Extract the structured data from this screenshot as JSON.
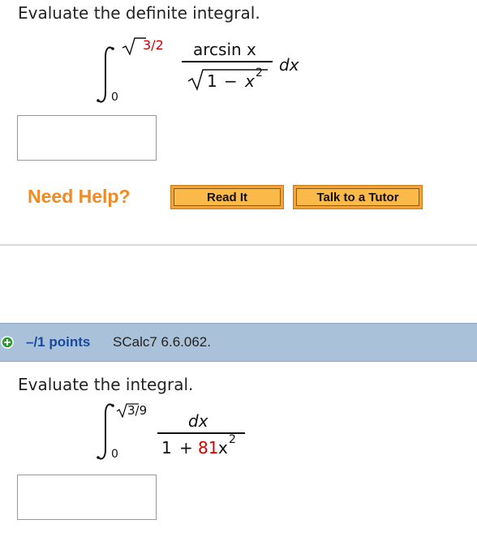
{
  "q1": {
    "prompt": "Evaluate the definite integral.",
    "upper_limit": "3/2",
    "lower_limit": "0",
    "numerator": "arcsin x",
    "denom_one": "1",
    "denom_minus": "−",
    "denom_x": "x",
    "denom_pow": "2",
    "differential": "dx"
  },
  "help": {
    "label": "Need Help?",
    "read_it": "Read It",
    "talk_tutor": "Talk to a Tutor"
  },
  "q2_header": {
    "icon": "plus-circle-icon",
    "points": "–/1 points",
    "source": "SCalc7 6.6.062."
  },
  "q2": {
    "prompt": "Evaluate the integral.",
    "upper_limit": "3/9",
    "lower_limit": "0",
    "numerator": "dx",
    "denom_one": "1",
    "denom_plus": "+",
    "denom_coef": "81",
    "denom_x": "x",
    "denom_pow": "2"
  },
  "colors": {
    "accent_orange": "#f08a24",
    "bar_blue": "#a9c2d9",
    "link_blue": "#1a4aa0",
    "highlight_red": "#d60000",
    "icon_green": "#2a9a2a"
  }
}
